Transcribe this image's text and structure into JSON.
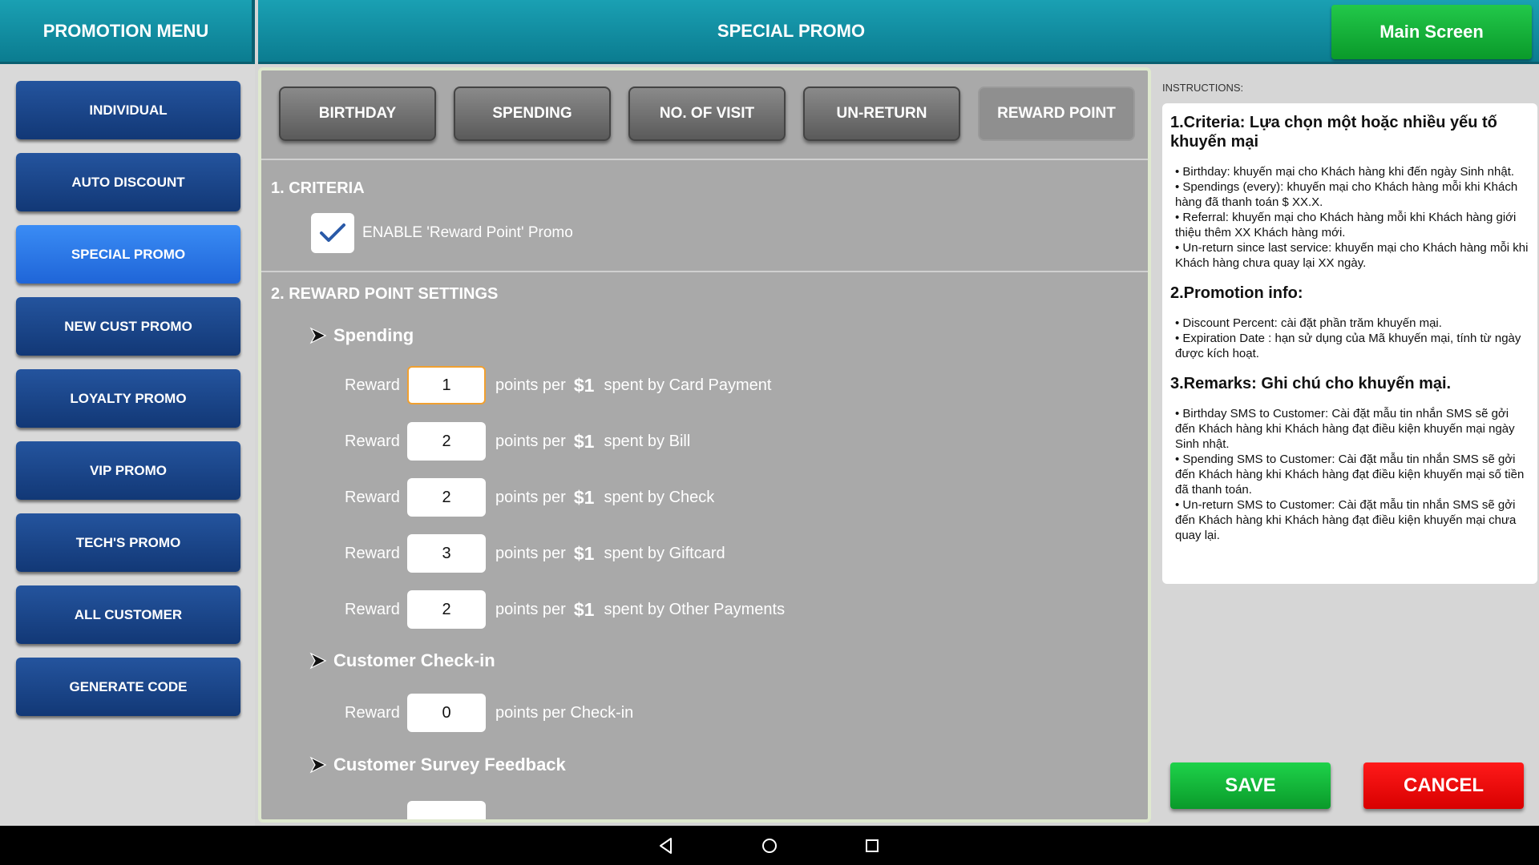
{
  "header": {
    "left_title": "PROMOTION MENU",
    "center_title": "SPECIAL PROMO",
    "main_screen_label": "Main Screen"
  },
  "sidebar": {
    "items": [
      {
        "label": "INDIVIDUAL",
        "active": false
      },
      {
        "label": "AUTO DISCOUNT",
        "active": false
      },
      {
        "label": "SPECIAL PROMO",
        "active": true
      },
      {
        "label": "NEW CUST PROMO",
        "active": false
      },
      {
        "label": "LOYALTY PROMO",
        "active": false
      },
      {
        "label": "VIP PROMO",
        "active": false
      },
      {
        "label": "TECH'S PROMO",
        "active": false
      },
      {
        "label": "ALL CUSTOMER",
        "active": false
      },
      {
        "label": "GENERATE CODE",
        "active": false
      }
    ]
  },
  "tabs": [
    {
      "label": "BIRTHDAY",
      "active": false
    },
    {
      "label": "SPENDING",
      "active": false
    },
    {
      "label": "NO. OF VISIT",
      "active": false
    },
    {
      "label": "UN-RETURN",
      "active": false
    },
    {
      "label": "REWARD POINT",
      "active": true
    }
  ],
  "criteria": {
    "title": "1. CRITERIA",
    "checkbox_checked": true,
    "checkbox_label": "ENABLE 'Reward Point' Promo"
  },
  "settings": {
    "title": "2. REWARD POINT SETTINGS",
    "spending": {
      "title": "Spending",
      "reward_label": "Reward",
      "points_per": "points per",
      "currency": "$1",
      "rows": [
        {
          "value": "1",
          "suffix": "spent by Card Payment"
        },
        {
          "value": "2",
          "suffix": "spent by Bill"
        },
        {
          "value": "2",
          "suffix": "spent by Check"
        },
        {
          "value": "3",
          "suffix": "spent by Giftcard"
        },
        {
          "value": "2",
          "suffix": "spent by Other Payments"
        }
      ]
    },
    "checkin": {
      "title": "Customer Check-in",
      "reward_label": "Reward",
      "value": "0",
      "suffix": "points per Check-in"
    },
    "survey": {
      "title": "Customer Survey Feedback"
    }
  },
  "instructions": {
    "label": "INSTRUCTIONS:",
    "sections": [
      {
        "heading": "1.Criteria: Lựa chọn một hoặc nhiều yếu tố khuyến mại",
        "bullets": [
          "• Birthday: khuyến mại cho Khách hàng khi đến ngày Sinh nhật.",
          "• Spendings (every): khuyến mại cho Khách hàng mỗi khi Khách hàng đã thanh toán $ XX.X.",
          "• Referral: khuyến mại cho Khách hàng mỗi khi Khách hàng giới thiệu thêm XX Khách hàng mới.",
          "• Un-return since last service: khuyến mại cho Khách hàng mỗi khi Khách hàng chưa quay lại XX ngày."
        ]
      },
      {
        "heading": "2.Promotion info:",
        "bullets": [
          "• Discount Percent: cài đặt phần trăm khuyến mại.",
          "• Expiration Date : hạn sử dụng của Mã khuyến mại, tính từ ngày được kích hoạt."
        ]
      },
      {
        "heading": "3.Remarks: Ghi chú cho khuyến mại.",
        "bullets": [
          "• Birthday SMS to Customer: Cài đặt mẫu tin nhắn SMS sẽ gởi đến Khách hàng khi Khách hàng đạt điều kiện khuyến mại ngày Sinh nhật.",
          "• Spending SMS to Customer: Cài đặt mẫu tin nhắn SMS sẽ gởi đến Khách hàng khi Khách hàng đạt điều kiện khuyến mại số tiền đã thanh toán.",
          "• Un-return SMS to Customer: Cài đặt mẫu tin nhắn SMS sẽ gởi đến Khách hàng khi Khách hàng đạt điều kiện khuyến mại chưa quay lại."
        ]
      }
    ]
  },
  "actions": {
    "save_label": "SAVE",
    "cancel_label": "CANCEL"
  },
  "navbar": {
    "icons": [
      "back-icon",
      "home-icon",
      "recents-icon"
    ]
  }
}
